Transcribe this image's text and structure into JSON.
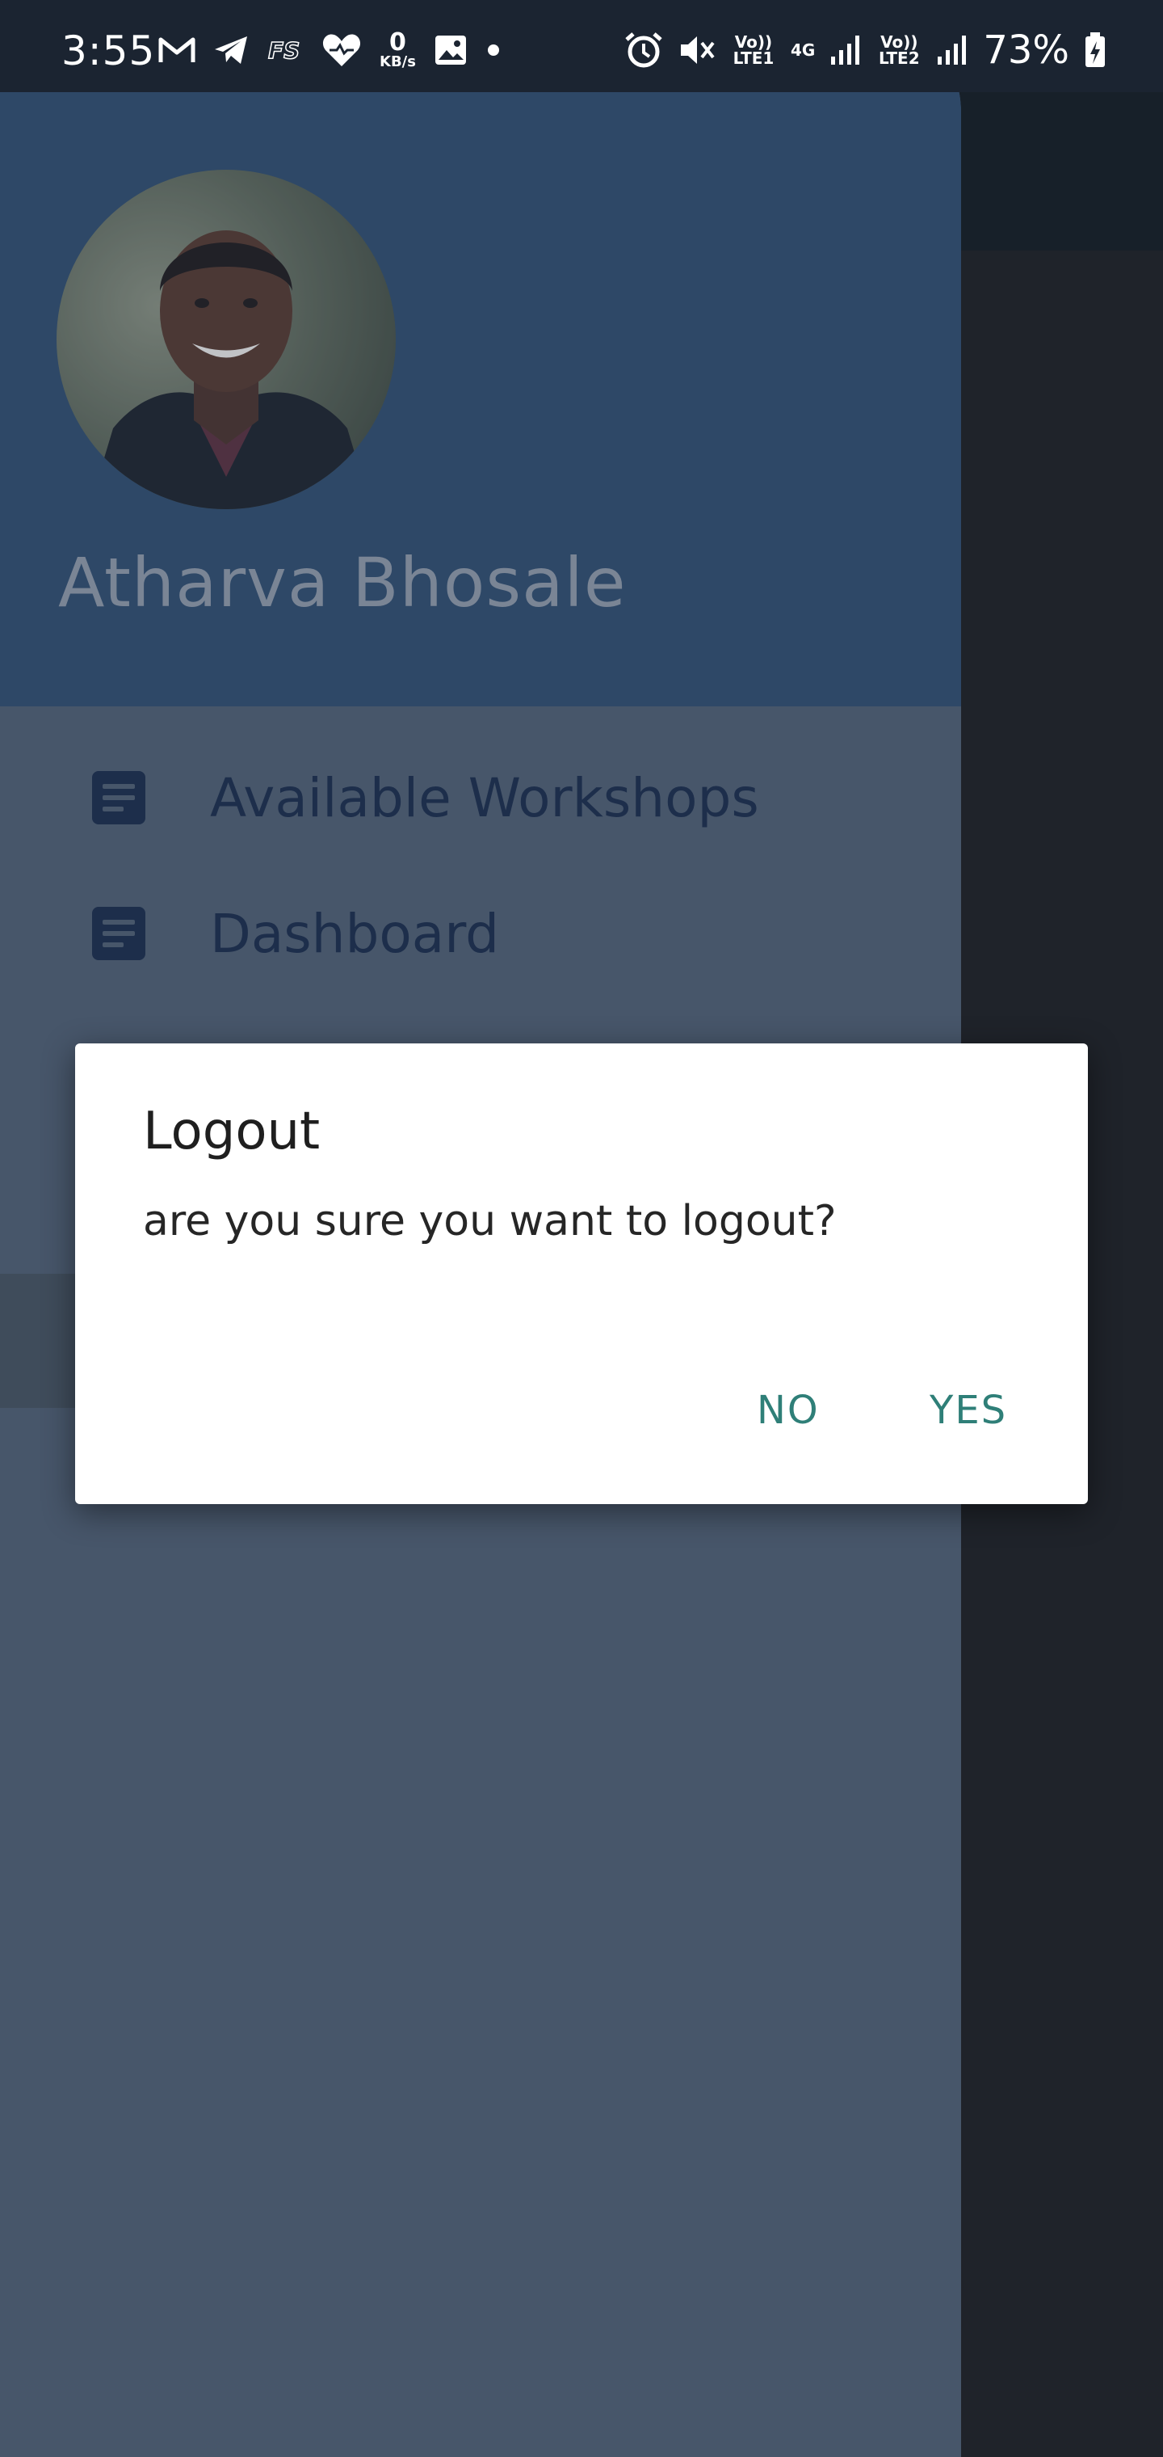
{
  "status_bar": {
    "time": "3:55",
    "speed_value": "0",
    "speed_unit": "KB/s",
    "net1_label": "Vo)) LTE1",
    "net_type": "4G",
    "net2_label": "Vo)) LTE2",
    "battery": "73%",
    "left_icons": [
      "gmail-icon",
      "telegram-icon",
      "fs-icon",
      "health-heart-icon",
      "gallery-icon",
      "dot-icon"
    ],
    "right_icons": [
      "alarm-icon",
      "mute-icon",
      "signal-icon",
      "battery-charging-icon"
    ]
  },
  "drawer": {
    "user_name": "Atharva Bhosale",
    "menu_items": [
      {
        "label": "Available Workshops",
        "icon": "document-icon"
      },
      {
        "label": "Dashboard",
        "icon": "document-icon"
      }
    ]
  },
  "dialog": {
    "title": "Logout",
    "message": "are you sure you want to logout?",
    "no_label": "NO",
    "yes_label": "YES",
    "accent_color": "#2f7f78"
  },
  "colors": {
    "drawer_header": "#2e4867",
    "drawer_body": "#47566a",
    "menu_text": "#1d2e4b"
  }
}
